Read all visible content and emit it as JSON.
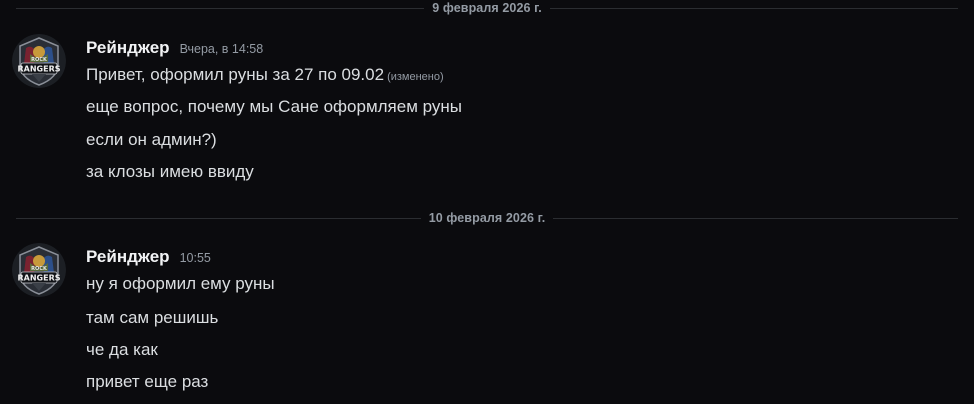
{
  "dividers": [
    {
      "label": "9 февраля 2026 г."
    },
    {
      "label": "10 февраля 2026 г."
    }
  ],
  "groups": [
    {
      "author": "Рейнджер",
      "timestamp": "Вчера, в 14:58",
      "avatar_icon": "rangers-logo-icon",
      "messages": [
        {
          "text": "Привет, оформил руны за 27 по 09.02",
          "edited": "(изменено)"
        },
        {
          "text": "еще вопрос, почему мы Сане оформляем руны"
        },
        {
          "text": "если он админ?)"
        },
        {
          "text": "за клозы имею ввиду"
        }
      ]
    },
    {
      "author": "Рейнджер",
      "timestamp": "10:55",
      "avatar_icon": "rangers-logo-icon",
      "messages": [
        {
          "text": "ну я оформил ему руны"
        },
        {
          "text": "там сам решишь"
        },
        {
          "text": "че да как"
        },
        {
          "text": "привет еще раз"
        }
      ]
    }
  ],
  "avatar_text": {
    "top": "ROCK",
    "bottom": "RANGERS"
  },
  "colors": {
    "background": "#0b0b0e",
    "author": "#f2f3f5",
    "message": "#dbdee1",
    "muted": "#949ba4",
    "divider": "#2b2d31"
  }
}
